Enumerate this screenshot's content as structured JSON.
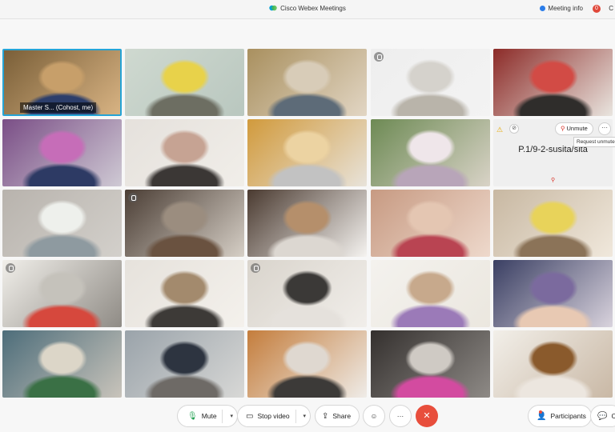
{
  "app": {
    "title": "Cisco Webex Meetings",
    "meeting_info": "Meeting info",
    "record_badge": "0",
    "truncated_right": "C"
  },
  "tiles": [
    {
      "name": "Master S...",
      "role": "(Cohost, me)",
      "active": true,
      "colors": [
        "#7a5f38",
        "#c79f6a",
        "#2c3e6b",
        "#d8b383"
      ]
    },
    {
      "name": "",
      "colors": [
        "#cfd9d0",
        "#e8d24a",
        "#6d6e62",
        "#b9c7bf"
      ]
    },
    {
      "name": "",
      "colors": [
        "#a9905f",
        "#d8ccb8",
        "#5d6b78",
        "#e2d6c4"
      ]
    },
    {
      "name": "",
      "colors": [
        "#eeeeee",
        "#d5d2cc",
        "#b9b4aa",
        "#f3f3f3"
      ]
    },
    {
      "name": "",
      "colors": [
        "#8c2b28",
        "#d24b45",
        "#2f2d2b",
        "#e9e5df"
      ]
    },
    {
      "name": "",
      "colors": [
        "#7a4e86",
        "#c66db8",
        "#2d3a64",
        "#cfcad4"
      ]
    },
    {
      "name": "",
      "colors": [
        "#e5e1dc",
        "#c6a393",
        "#3b3735",
        "#f1eee9"
      ]
    },
    {
      "name": "",
      "colors": [
        "#d19a3c",
        "#ecd3a2",
        "#c2c2c2",
        "#e8e3da"
      ]
    },
    {
      "name": "",
      "colors": [
        "#6d8a54",
        "#efe6ea",
        "#b8a5b9",
        "#d9d3c7"
      ]
    },
    {
      "audio": true,
      "display_name": "P.1/9-2-susita/sita",
      "unmute_label": "Unmute",
      "more_label": "···"
    },
    {
      "name": "",
      "colors": [
        "#b8b3ad",
        "#eef0ec",
        "#8e9aa0",
        "#d3d0cb"
      ]
    },
    {
      "name": "",
      "colors": [
        "#4b3e35",
        "#9b8d7f",
        "#6a5240",
        "#d6cfc6"
      ]
    },
    {
      "name": "",
      "colors": [
        "#4a3a30",
        "#b58f6b",
        "#dcd7d1",
        "#f5f3f0"
      ]
    },
    {
      "name": "",
      "colors": [
        "#c79a82",
        "#e4c6b2",
        "#b94452",
        "#eed9cc"
      ]
    },
    {
      "name": "",
      "colors": [
        "#c8b8a2",
        "#e8d35a",
        "#8b7358",
        "#f0e8dc"
      ]
    },
    {
      "name": "",
      "colors": [
        "#f1efea",
        "#c5c2bb",
        "#d6483d",
        "#8f8b85"
      ]
    },
    {
      "name": "",
      "colors": [
        "#e6e2dc",
        "#a38a6d",
        "#3d3a37",
        "#f4f1ec"
      ]
    },
    {
      "name": "",
      "colors": [
        "#d9d4cc",
        "#3b3937",
        "#e5e1dc",
        "#f1eeea"
      ]
    },
    {
      "name": "",
      "colors": [
        "#f4f2ee",
        "#c7a98c",
        "#9b7ab8",
        "#ebe7df"
      ]
    },
    {
      "name": "",
      "colors": [
        "#3a3f63",
        "#7b6a9e",
        "#e8c9b3",
        "#d9d3dd"
      ]
    },
    {
      "name": "",
      "colors": [
        "#4d6d7a",
        "#dcd6c8",
        "#3a7045",
        "#c9c4bb"
      ]
    },
    {
      "name": "",
      "colors": [
        "#9aa3aa",
        "#2d3440",
        "#6e6a66",
        "#d8d8d6"
      ]
    },
    {
      "name": "",
      "colors": [
        "#c47d3c",
        "#dfd8d0",
        "#3c3a38",
        "#efece8"
      ]
    },
    {
      "name": "",
      "colors": [
        "#34302e",
        "#cfcac4",
        "#d34ba0",
        "#8e8a86"
      ]
    },
    {
      "name": "",
      "colors": [
        "#f2efe9",
        "#8a5a2c",
        "#ece6df",
        "#c9b8a5"
      ]
    }
  ],
  "tooltip": "Request unmute",
  "controls": {
    "mute_label": "Mute",
    "video_label": "Stop video",
    "share_label": "Share",
    "participants_label": "Participants",
    "chat_label": "Ch"
  }
}
